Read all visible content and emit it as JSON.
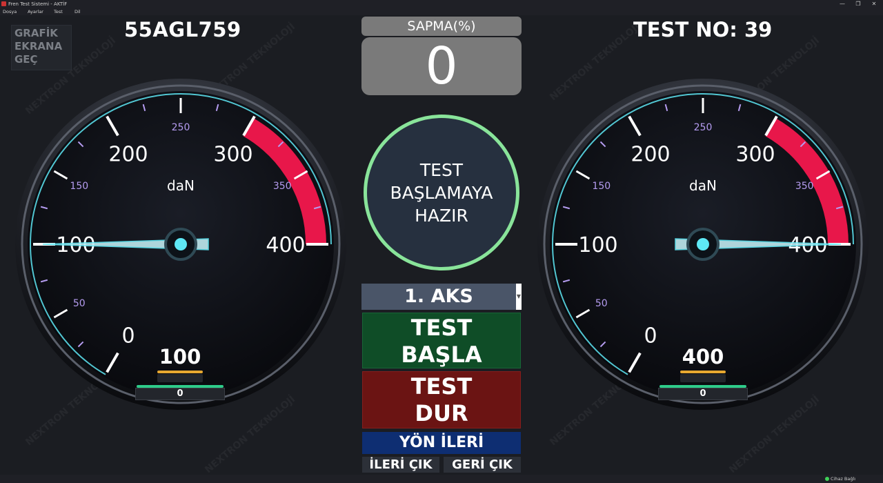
{
  "window": {
    "title": "Fren Test Sistemi - AKTİF",
    "controls": [
      "—",
      "❐",
      "✕"
    ]
  },
  "menu": [
    "Dosya",
    "Ayarlar",
    "Test",
    "Dil"
  ],
  "grafik_button": "GRAFİK\nEKRANA\nGEÇ",
  "plate": "55AGL759",
  "test_no": "TEST NO: 39",
  "sapma": {
    "label": "SAPMA(%)",
    "value": "0"
  },
  "status_text": "TEST\nBAŞLAMAYA\nHAZIR",
  "aks_select": "1. AKS",
  "buttons": {
    "start": "TEST\nBAŞLA",
    "stop": "TEST\nDUR",
    "direction": "YÖN İLERİ",
    "exit_forward": "İLERİ ÇIK",
    "exit_backward": "GERİ ÇIK"
  },
  "gauges": [
    {
      "unit": "daN",
      "major_ticks": [
        "0",
        "100",
        "200",
        "300",
        "400"
      ],
      "minor_ticks": [
        "50",
        "150",
        "250",
        "350"
      ],
      "min": 0,
      "max": 400,
      "red_zone_start": 300,
      "value": 100,
      "readout": "100",
      "sub_readout": "0"
    },
    {
      "unit": "daN",
      "major_ticks": [
        "0",
        "100",
        "200",
        "300",
        "400"
      ],
      "minor_ticks": [
        "50",
        "150",
        "250",
        "350"
      ],
      "min": 0,
      "max": 400,
      "red_zone_start": 300,
      "value": 400,
      "readout": "400",
      "sub_readout": "0"
    }
  ],
  "statusbar": {
    "connection": "Cihaz Bağlı"
  },
  "colors": {
    "accent_cyan": "#5ee8f5",
    "red_zone": "#e8174a",
    "minor_label": "#b59cf0",
    "ready_ring": "#89e49a",
    "start_green": "#0f4d27",
    "stop_red": "#6b1413",
    "direction_blue": "#0e2e72"
  }
}
